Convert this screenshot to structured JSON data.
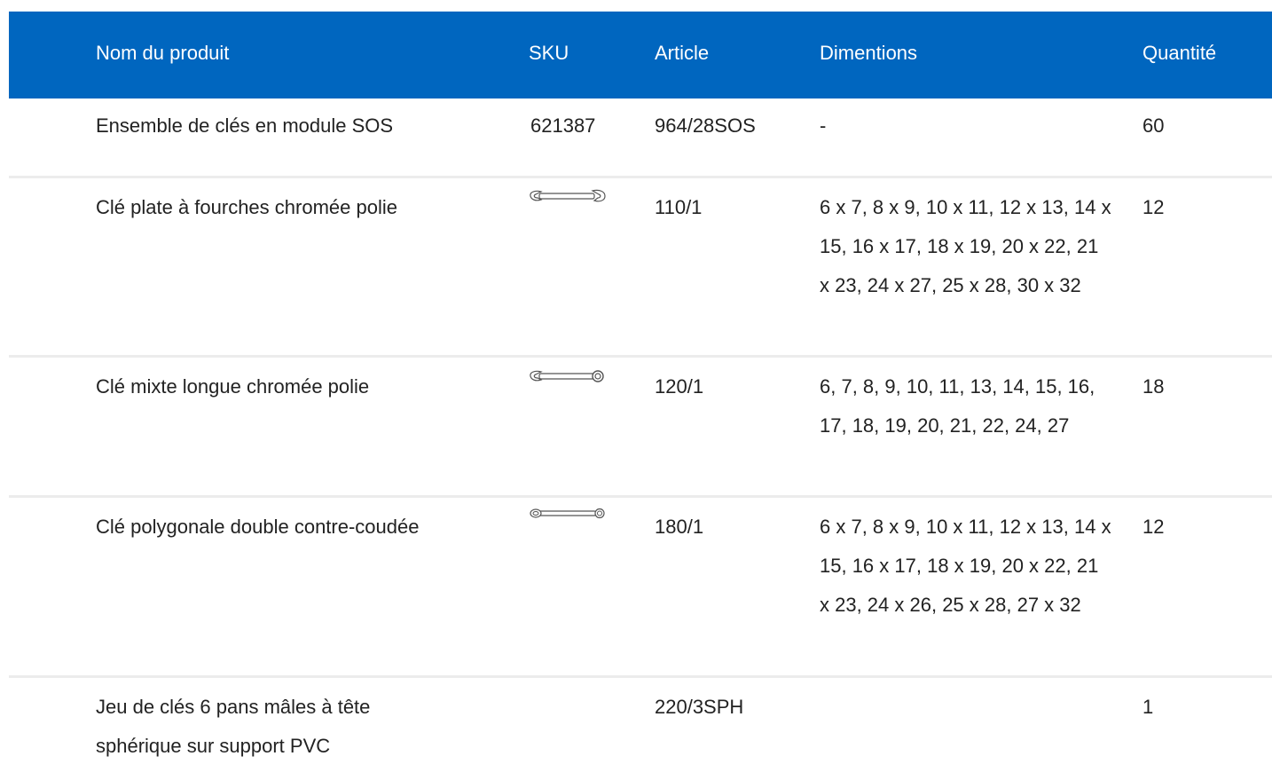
{
  "table": {
    "headers": {
      "name": "Nom du produit",
      "sku": "SKU",
      "article": "Article",
      "dimensions": "Dimentions",
      "quantity": "Quantité"
    },
    "rows": [
      {
        "name": "Ensemble de clés en module SOS",
        "sku": "621387",
        "sku_icon": "",
        "article": "964/28SOS",
        "dimensions": "-",
        "quantity": "60"
      },
      {
        "name": "Clé plate à fourches chromée polie",
        "sku": "",
        "sku_icon": "open-end-wrench-icon",
        "article": "110/1",
        "dimensions": "6 x 7, 8 x 9, 10 x 11, 12 x 13, 14 x 15, 16 x 17, 18 x 19, 20 x 22, 21 x 23, 24 x 27, 25 x 28, 30 x 32",
        "quantity": "12"
      },
      {
        "name": "Clé mixte longue chromée polie",
        "sku": "",
        "sku_icon": "combination-wrench-icon",
        "article": "120/1",
        "dimensions": "6, 7, 8, 9, 10, 11, 13, 14, 15, 16, 17, 18, 19, 20, 21, 22, 24, 27",
        "quantity": "18"
      },
      {
        "name": "Clé polygonale double contre-coudée",
        "sku": "",
        "sku_icon": "double-ring-wrench-icon",
        "article": "180/1",
        "dimensions": "6 x 7, 8 x 9, 10 x 11, 12 x 13, 14 x 15, 16 x 17, 18 x 19, 20 x 22, 21 x 23, 24 x 26, 25 x 28, 27 x 32",
        "quantity": "12"
      },
      {
        "name": "Jeu de clés 6 pans mâles à tête sphérique sur support PVC",
        "sku": "",
        "sku_icon": "",
        "article": "220/3SPH",
        "dimensions": "",
        "quantity": "1"
      }
    ]
  },
  "colors": {
    "header_bg": "#0066bf",
    "header_text": "#ffffff",
    "body_text": "#222222",
    "row_divider": "#ececec"
  }
}
